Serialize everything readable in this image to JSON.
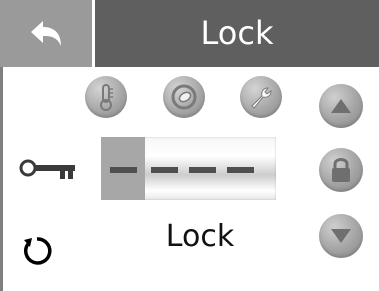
{
  "header": {
    "back_icon": "back-arrow-icon",
    "title": "Lock"
  },
  "mode_icons": [
    "thermometer-icon",
    "dial-icon",
    "wrench-icon"
  ],
  "key_icon": "key-icon",
  "code_display": {
    "digit_count": 4,
    "selected_digit": 1,
    "placeholder": "----"
  },
  "status_label": "Lock",
  "reset_icon": "reset-icon",
  "side_buttons": {
    "up_icon": "triangle-up-icon",
    "lock_icon": "padlock-icon",
    "down_icon": "triangle-down-icon"
  },
  "colors": {
    "header_bg": "#5f5f5f",
    "back_bg": "#9a9a9a",
    "icon_gray": "#a7a7a7",
    "dash": "#4f4f4f"
  }
}
